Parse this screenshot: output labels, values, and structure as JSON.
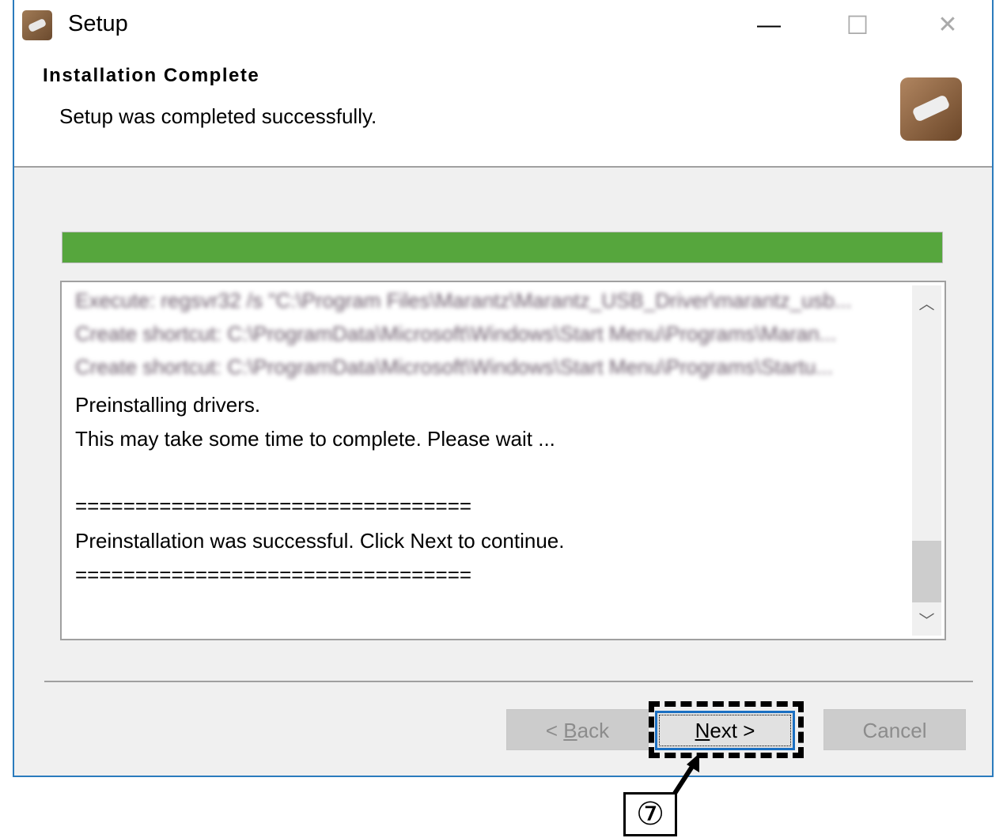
{
  "window": {
    "title": "Setup",
    "minimize": "—",
    "maximize": "☐",
    "close": "✕",
    "accent": "#2b7bbd"
  },
  "header": {
    "title": "Installation Complete",
    "subtitle": "Setup was completed successfully."
  },
  "progress": {
    "percent": 100,
    "color": "#56a63d"
  },
  "log": {
    "lines": [
      {
        "text": "Execute: regsvr32 /s \"C:\\Program Files\\Marantz\\Marantz_USB_Driver\\marantz_usb...",
        "blurred": true
      },
      {
        "text": "Create shortcut: C:\\ProgramData\\Microsoft\\Windows\\Start Menu\\Programs\\Maran...",
        "blurred": true
      },
      {
        "text": "Create shortcut: C:\\ProgramData\\Microsoft\\Windows\\Start Menu\\Programs\\Startu...",
        "blurred": true
      },
      {
        "text": "Preinstalling drivers."
      },
      {
        "text": "This may take some time to complete. Please wait ..."
      },
      {
        "text": ""
      },
      {
        "text": "================================="
      },
      {
        "text": "Preinstallation was successful. Click Next to continue."
      },
      {
        "text": "================================="
      }
    ]
  },
  "buttons": {
    "back": {
      "prefix": "< ",
      "key": "B",
      "rest": "ack"
    },
    "next": {
      "key": "N",
      "rest": "ext >"
    },
    "cancel": "Cancel"
  },
  "callout": {
    "label": "⑦"
  }
}
